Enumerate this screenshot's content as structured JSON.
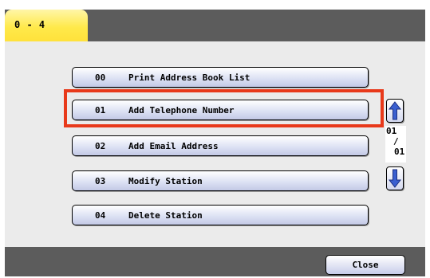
{
  "tab": {
    "label": "0 - 4"
  },
  "menu": {
    "items": [
      {
        "num": "00",
        "label": "Print Address Book List"
      },
      {
        "num": "01",
        "label": "Add Telephone Number"
      },
      {
        "num": "02",
        "label": "Add Email Address"
      },
      {
        "num": "03",
        "label": "Modify Station"
      },
      {
        "num": "04",
        "label": "Delete Station"
      }
    ],
    "highlight_color": "#e8391a"
  },
  "pager": {
    "current": "01",
    "separator": "/",
    "total": "01"
  },
  "footer": {
    "close_label": "Close"
  },
  "colors": {
    "bar": "#5c5c5c",
    "panel": "#ebebeb",
    "tab": "#ffe94a",
    "button": "#dde2f4",
    "arrow": "#3a5fd0"
  }
}
